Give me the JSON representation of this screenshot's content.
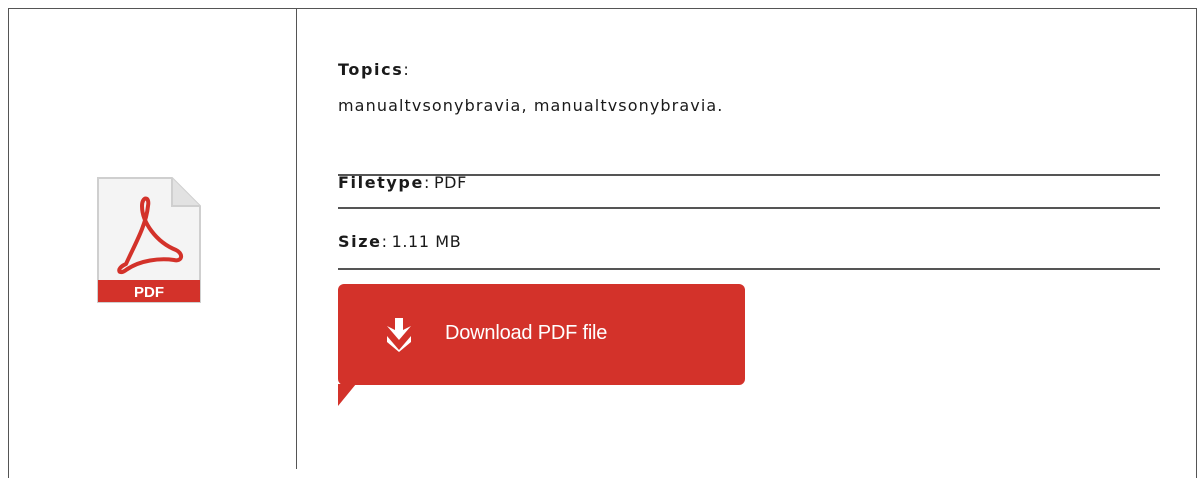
{
  "topics": {
    "label": "Topics",
    "separator": ":",
    "value": "manualtvsonybravia, manualtvsonybravia."
  },
  "filetype": {
    "label": "Filetype",
    "separator": ":",
    "value": "PDF"
  },
  "size": {
    "label": "Size",
    "separator": ":",
    "value": "1.11 MB"
  },
  "download": {
    "label": "Download PDF file"
  },
  "file_icon": {
    "name": "pdf-file-icon",
    "badge_text": "PDF",
    "accent_color": "#d3322a"
  },
  "colors": {
    "button": "#d3322a",
    "border": "#555555",
    "text": "#1a1a1a"
  }
}
